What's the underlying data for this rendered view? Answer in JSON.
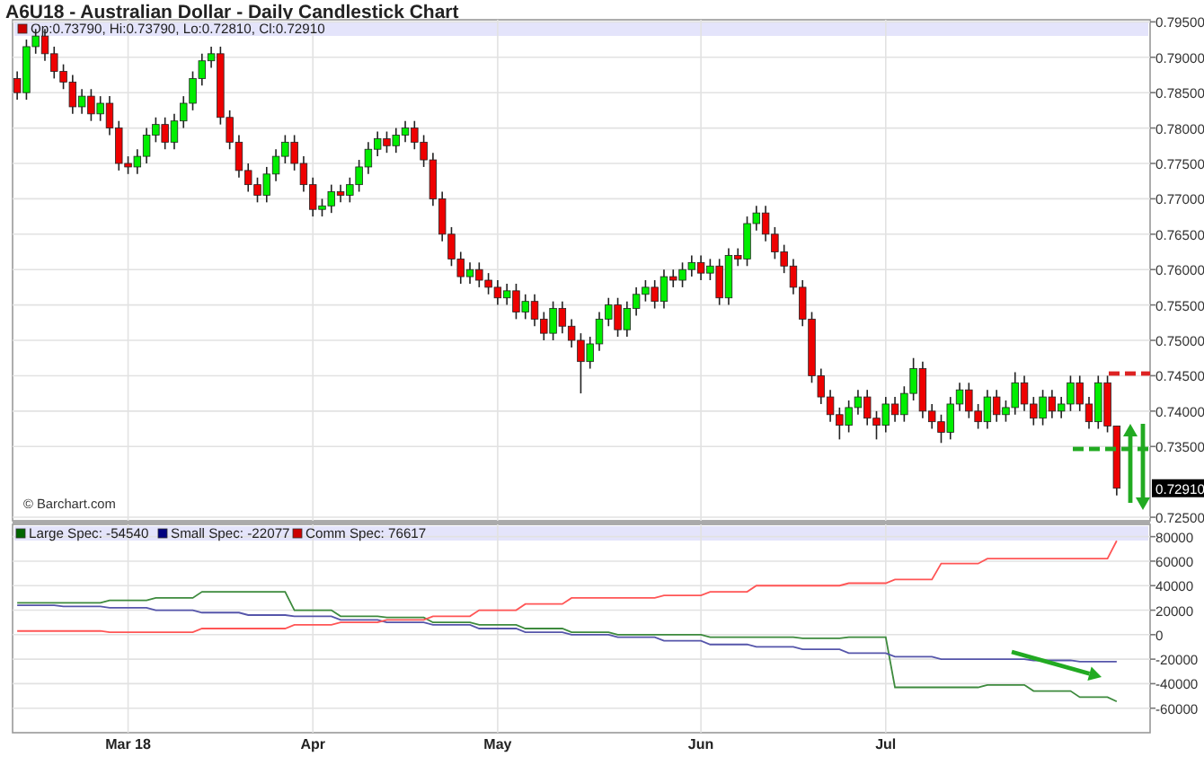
{
  "title": "A6U18 - Australian Dollar - Daily Candlestick Chart",
  "price_chart": {
    "legend": {
      "color": "#cc0000",
      "text": "Op:0.73790, Hi:0.73790, Lo:0.72810, Cl:0.72910"
    },
    "credit": "© Barchart.com",
    "last_price_label": "0.72910",
    "chart_data": {
      "type": "candlestick",
      "categories": [
        null,
        null,
        null,
        null,
        null,
        null,
        null,
        null,
        null,
        null,
        null,
        null,
        null,
        null,
        null,
        null,
        null,
        null,
        null,
        null,
        null,
        null,
        null,
        null,
        null,
        null,
        null,
        null,
        null,
        null,
        null,
        null,
        null,
        null,
        null,
        null,
        null,
        null,
        null,
        null,
        null,
        null,
        null,
        null,
        null,
        null,
        null,
        null,
        null,
        null,
        null,
        null,
        null,
        null,
        null,
        null,
        null,
        null,
        null,
        null,
        null,
        null,
        null,
        null,
        null,
        null,
        null,
        null,
        null,
        null,
        null,
        null,
        null,
        null,
        null,
        null,
        null,
        null,
        null,
        null,
        null,
        null,
        null,
        null,
        null,
        null,
        null,
        null,
        null,
        null,
        null,
        null,
        null,
        null,
        null,
        null,
        null,
        null,
        null,
        null,
        null,
        null,
        null,
        null,
        null,
        null,
        null,
        null,
        null,
        null,
        null,
        null,
        null,
        null,
        null,
        null,
        null,
        null,
        null,
        null
      ],
      "ylim": [
        0.7245,
        0.7953
      ],
      "grid": true,
      "yticks": [
        {
          "value": 0.795,
          "label": "0.79500"
        },
        {
          "value": 0.79,
          "label": "0.79000"
        },
        {
          "value": 0.785,
          "label": "0.78500"
        },
        {
          "value": 0.78,
          "label": "0.78000"
        },
        {
          "value": 0.775,
          "label": "0.77500"
        },
        {
          "value": 0.77,
          "label": "0.77000"
        },
        {
          "value": 0.765,
          "label": "0.76500"
        },
        {
          "value": 0.76,
          "label": "0.76000"
        },
        {
          "value": 0.755,
          "label": "0.75500"
        },
        {
          "value": 0.75,
          "label": "0.75000"
        },
        {
          "value": 0.745,
          "label": "0.74500"
        },
        {
          "value": 0.74,
          "label": "0.74000"
        },
        {
          "value": 0.735,
          "label": "0.73500"
        },
        {
          "value": 0.725,
          "label": "0.72500"
        }
      ],
      "ohlc": [
        [
          0.787,
          0.788,
          0.784,
          0.785
        ],
        [
          0.785,
          0.7925,
          0.784,
          0.7915
        ],
        [
          0.7915,
          0.794,
          0.7905,
          0.793
        ],
        [
          0.793,
          0.794,
          0.7895,
          0.7905
        ],
        [
          0.7905,
          0.7915,
          0.787,
          0.788
        ],
        [
          0.788,
          0.789,
          0.7855,
          0.7865
        ],
        [
          0.7865,
          0.7875,
          0.782,
          0.783
        ],
        [
          0.783,
          0.7855,
          0.782,
          0.7845
        ],
        [
          0.7845,
          0.7855,
          0.781,
          0.782
        ],
        [
          0.782,
          0.7845,
          0.781,
          0.7835
        ],
        [
          0.7835,
          0.7845,
          0.779,
          0.78
        ],
        [
          0.78,
          0.781,
          0.774,
          0.775
        ],
        [
          0.775,
          0.776,
          0.7735,
          0.7745
        ],
        [
          0.7745,
          0.777,
          0.7735,
          0.776
        ],
        [
          0.776,
          0.78,
          0.775,
          0.779
        ],
        [
          0.779,
          0.7815,
          0.778,
          0.7805
        ],
        [
          0.7805,
          0.7815,
          0.777,
          0.778
        ],
        [
          0.778,
          0.782,
          0.777,
          0.781
        ],
        [
          0.781,
          0.7845,
          0.78,
          0.7835
        ],
        [
          0.7835,
          0.788,
          0.7825,
          0.787
        ],
        [
          0.787,
          0.7905,
          0.786,
          0.7895
        ],
        [
          0.7895,
          0.7915,
          0.7885,
          0.7905
        ],
        [
          0.7905,
          0.7915,
          0.7805,
          0.7815
        ],
        [
          0.7815,
          0.7825,
          0.777,
          0.778
        ],
        [
          0.778,
          0.779,
          0.773,
          0.774
        ],
        [
          0.774,
          0.775,
          0.771,
          0.772
        ],
        [
          0.772,
          0.773,
          0.7695,
          0.7705
        ],
        [
          0.7705,
          0.7745,
          0.7695,
          0.7735
        ],
        [
          0.7735,
          0.777,
          0.7725,
          0.776
        ],
        [
          0.776,
          0.779,
          0.775,
          0.778
        ],
        [
          0.778,
          0.779,
          0.774,
          0.775
        ],
        [
          0.775,
          0.776,
          0.771,
          0.772
        ],
        [
          0.772,
          0.773,
          0.7675,
          0.7685
        ],
        [
          0.7685,
          0.77,
          0.7675,
          0.769
        ],
        [
          0.769,
          0.772,
          0.768,
          0.771
        ],
        [
          0.771,
          0.772,
          0.7695,
          0.7705
        ],
        [
          0.7705,
          0.773,
          0.7695,
          0.772
        ],
        [
          0.772,
          0.7755,
          0.771,
          0.7745
        ],
        [
          0.7745,
          0.778,
          0.7735,
          0.777
        ],
        [
          0.777,
          0.7795,
          0.776,
          0.7785
        ],
        [
          0.7785,
          0.7795,
          0.7765,
          0.7775
        ],
        [
          0.7775,
          0.78,
          0.7765,
          0.779
        ],
        [
          0.779,
          0.781,
          0.778,
          0.78
        ],
        [
          0.78,
          0.781,
          0.777,
          0.778
        ],
        [
          0.778,
          0.779,
          0.7745,
          0.7755
        ],
        [
          0.7755,
          0.7765,
          0.769,
          0.77
        ],
        [
          0.77,
          0.771,
          0.764,
          0.765
        ],
        [
          0.765,
          0.766,
          0.7605,
          0.7615
        ],
        [
          0.7615,
          0.7625,
          0.758,
          0.759
        ],
        [
          0.759,
          0.761,
          0.758,
          0.76
        ],
        [
          0.76,
          0.761,
          0.7575,
          0.7585
        ],
        [
          0.7585,
          0.7595,
          0.7565,
          0.7575
        ],
        [
          0.7575,
          0.7585,
          0.755,
          0.756
        ],
        [
          0.756,
          0.758,
          0.755,
          0.757
        ],
        [
          0.757,
          0.758,
          0.753,
          0.754
        ],
        [
          0.754,
          0.7565,
          0.753,
          0.7555
        ],
        [
          0.7555,
          0.7565,
          0.752,
          0.753
        ],
        [
          0.753,
          0.754,
          0.75,
          0.751
        ],
        [
          0.751,
          0.7555,
          0.75,
          0.7545
        ],
        [
          0.7545,
          0.7555,
          0.751,
          0.752
        ],
        [
          0.752,
          0.753,
          0.749,
          0.75
        ],
        [
          0.75,
          0.751,
          0.7425,
          0.747
        ],
        [
          0.747,
          0.7505,
          0.746,
          0.7495
        ],
        [
          0.7495,
          0.754,
          0.7485,
          0.753
        ],
        [
          0.753,
          0.756,
          0.752,
          0.755
        ],
        [
          0.755,
          0.756,
          0.7505,
          0.7515
        ],
        [
          0.7515,
          0.7555,
          0.7505,
          0.7545
        ],
        [
          0.7545,
          0.7575,
          0.7535,
          0.7565
        ],
        [
          0.7565,
          0.7585,
          0.7555,
          0.7575
        ],
        [
          0.7575,
          0.7585,
          0.7545,
          0.7555
        ],
        [
          0.7555,
          0.76,
          0.7545,
          0.759
        ],
        [
          0.759,
          0.76,
          0.7575,
          0.7585
        ],
        [
          0.7585,
          0.761,
          0.7575,
          0.76
        ],
        [
          0.76,
          0.762,
          0.759,
          0.761
        ],
        [
          0.761,
          0.762,
          0.7585,
          0.7595
        ],
        [
          0.7595,
          0.7615,
          0.7585,
          0.7605
        ],
        [
          0.7605,
          0.7615,
          0.755,
          0.756
        ],
        [
          0.756,
          0.763,
          0.755,
          0.762
        ],
        [
          0.762,
          0.763,
          0.7605,
          0.7615
        ],
        [
          0.7615,
          0.7675,
          0.7605,
          0.7665
        ],
        [
          0.7665,
          0.769,
          0.7655,
          0.768
        ],
        [
          0.768,
          0.769,
          0.764,
          0.765
        ],
        [
          0.765,
          0.766,
          0.7615,
          0.7625
        ],
        [
          0.7625,
          0.7635,
          0.7595,
          0.7605
        ],
        [
          0.7605,
          0.7615,
          0.7565,
          0.7575
        ],
        [
          0.7575,
          0.7585,
          0.752,
          0.753
        ],
        [
          0.753,
          0.754,
          0.744,
          0.745
        ],
        [
          0.745,
          0.746,
          0.741,
          0.742
        ],
        [
          0.742,
          0.743,
          0.7385,
          0.7395
        ],
        [
          0.7395,
          0.7405,
          0.736,
          0.738
        ],
        [
          0.738,
          0.7415,
          0.737,
          0.7405
        ],
        [
          0.7405,
          0.743,
          0.7395,
          0.742
        ],
        [
          0.742,
          0.743,
          0.738,
          0.739
        ],
        [
          0.739,
          0.74,
          0.736,
          0.738
        ],
        [
          0.738,
          0.742,
          0.737,
          0.741
        ],
        [
          0.741,
          0.742,
          0.7385,
          0.7395
        ],
        [
          0.7395,
          0.7435,
          0.7385,
          0.7425
        ],
        [
          0.7425,
          0.7475,
          0.7415,
          0.746
        ],
        [
          0.746,
          0.747,
          0.739,
          0.74
        ],
        [
          0.74,
          0.741,
          0.7375,
          0.7385
        ],
        [
          0.7385,
          0.7395,
          0.7355,
          0.737
        ],
        [
          0.737,
          0.742,
          0.736,
          0.741
        ],
        [
          0.741,
          0.744,
          0.74,
          0.743
        ],
        [
          0.743,
          0.744,
          0.739,
          0.74
        ],
        [
          0.74,
          0.741,
          0.7375,
          0.7385
        ],
        [
          0.7385,
          0.743,
          0.7375,
          0.742
        ],
        [
          0.742,
          0.743,
          0.7385,
          0.7395
        ],
        [
          0.7395,
          0.7415,
          0.7385,
          0.7405
        ],
        [
          0.7405,
          0.7455,
          0.7395,
          0.744
        ],
        [
          0.744,
          0.745,
          0.74,
          0.741
        ],
        [
          0.741,
          0.742,
          0.738,
          0.739
        ],
        [
          0.739,
          0.743,
          0.738,
          0.742
        ],
        [
          0.742,
          0.743,
          0.739,
          0.74
        ],
        [
          0.74,
          0.742,
          0.739,
          0.741
        ],
        [
          0.741,
          0.745,
          0.74,
          0.744
        ],
        [
          0.744,
          0.745,
          0.74,
          0.741
        ],
        [
          0.741,
          0.742,
          0.7375,
          0.7385
        ],
        [
          0.7385,
          0.745,
          0.7375,
          0.744
        ],
        [
          0.744,
          0.745,
          0.737,
          0.7379
        ],
        [
          0.7379,
          0.7379,
          0.7281,
          0.7291
        ]
      ]
    },
    "markers": [
      {
        "kind": "dashed_line",
        "color": "#dd2222"
      },
      {
        "kind": "dashed_line",
        "color": "#22aa22"
      },
      {
        "kind": "arrow",
        "color": "#22aa22"
      },
      {
        "kind": "arrow",
        "color": "#22aa22"
      }
    ]
  },
  "cot_chart": {
    "legend": [
      {
        "text": "Large Spec: -54540",
        "color": "#006600"
      },
      {
        "text": "Small Spec: -22077",
        "color": "#000080"
      },
      {
        "text": "Comm Spec: 76617",
        "color": "#cc0000"
      }
    ],
    "chart_data": {
      "type": "line",
      "ylim": [
        -80000,
        90000
      ],
      "grid": true,
      "categories": [
        null,
        null,
        null,
        null,
        null,
        null,
        null,
        null,
        null,
        null,
        null,
        null,
        "Mar 18",
        null,
        null,
        null,
        null,
        null,
        null,
        null,
        null,
        null,
        null,
        null,
        null,
        null,
        null,
        null,
        null,
        null,
        null,
        null,
        "Apr",
        null,
        null,
        null,
        null,
        null,
        null,
        null,
        null,
        null,
        null,
        null,
        null,
        null,
        null,
        null,
        null,
        null,
        null,
        null,
        "May",
        null,
        null,
        null,
        null,
        null,
        null,
        null,
        null,
        null,
        null,
        null,
        null,
        null,
        null,
        null,
        null,
        null,
        null,
        null,
        null,
        null,
        "Jun",
        null,
        null,
        null,
        null,
        null,
        null,
        null,
        null,
        null,
        null,
        null,
        null,
        null,
        null,
        null,
        null,
        null,
        null,
        null,
        "Jul",
        null,
        null,
        null,
        null,
        null,
        null,
        null,
        null,
        null,
        null,
        null,
        null,
        null,
        null,
        null,
        null,
        null,
        null,
        null,
        null,
        null,
        null,
        null,
        null,
        null
      ],
      "yticks": [
        80000,
        60000,
        40000,
        20000,
        0,
        -20000,
        -40000,
        -60000
      ],
      "series": [
        {
          "color": "#3d8a3d",
          "values": [
            26000,
            26000,
            26000,
            26000,
            26000,
            26000,
            26000,
            26000,
            26000,
            26000,
            28000,
            28000,
            28000,
            28000,
            28000,
            30000,
            30000,
            30000,
            30000,
            30000,
            35000,
            35000,
            35000,
            35000,
            35000,
            35000,
            35000,
            35000,
            35000,
            35000,
            20000,
            20000,
            20000,
            20000,
            20000,
            15000,
            15000,
            15000,
            15000,
            15000,
            14000,
            14000,
            14000,
            14000,
            14000,
            10000,
            10000,
            10000,
            10000,
            10000,
            8000,
            8000,
            8000,
            8000,
            8000,
            5000,
            5000,
            5000,
            5000,
            5000,
            2000,
            2000,
            2000,
            2000,
            2000,
            0,
            0,
            0,
            0,
            0,
            0,
            0,
            0,
            0,
            0,
            -2000,
            -2000,
            -2000,
            -2000,
            -2000,
            -2000,
            -2000,
            -2000,
            -2000,
            -2000,
            -3000,
            -3000,
            -3000,
            -3000,
            -3000,
            -2000,
            -2000,
            -2000,
            -2000,
            -2000,
            -43000,
            -43000,
            -43000,
            -43000,
            -43000,
            -43000,
            -43000,
            -43000,
            -43000,
            -43000,
            -41000,
            -41000,
            -41000,
            -41000,
            -41000,
            -46000,
            -46000,
            -46000,
            -46000,
            -46000,
            -51000,
            -51000,
            -51000,
            -51000,
            -54540
          ]
        },
        {
          "color": "#5555aa",
          "values": [
            24000,
            24000,
            24000,
            24000,
            24000,
            23000,
            23000,
            23000,
            23000,
            23000,
            22000,
            22000,
            22000,
            22000,
            22000,
            20000,
            20000,
            20000,
            20000,
            20000,
            18000,
            18000,
            18000,
            18000,
            18000,
            16000,
            16000,
            16000,
            16000,
            16000,
            15000,
            15000,
            15000,
            15000,
            15000,
            12000,
            12000,
            12000,
            12000,
            12000,
            10000,
            10000,
            10000,
            10000,
            10000,
            8000,
            8000,
            8000,
            8000,
            8000,
            5000,
            5000,
            5000,
            5000,
            5000,
            2000,
            2000,
            2000,
            2000,
            2000,
            0,
            0,
            0,
            0,
            0,
            -2000,
            -2000,
            -2000,
            -2000,
            -2000,
            -5000,
            -5000,
            -5000,
            -5000,
            -5000,
            -8000,
            -8000,
            -8000,
            -8000,
            -8000,
            -10000,
            -10000,
            -10000,
            -10000,
            -10000,
            -12000,
            -12000,
            -12000,
            -12000,
            -12000,
            -15000,
            -15000,
            -15000,
            -15000,
            -15000,
            -18000,
            -18000,
            -18000,
            -18000,
            -18000,
            -20000,
            -20000,
            -20000,
            -20000,
            -20000,
            -20000,
            -20000,
            -20000,
            -20000,
            -20000,
            -21000,
            -21000,
            -21000,
            -21000,
            -21000,
            -22000,
            -22000,
            -22000,
            -22000,
            -22077
          ]
        },
        {
          "color": "#ff5555",
          "values": [
            3000,
            3000,
            3000,
            3000,
            3000,
            3000,
            3000,
            3000,
            3000,
            3000,
            2000,
            2000,
            2000,
            2000,
            2000,
            2000,
            2000,
            2000,
            2000,
            2000,
            5000,
            5000,
            5000,
            5000,
            5000,
            5000,
            5000,
            5000,
            5000,
            5000,
            8000,
            8000,
            8000,
            8000,
            8000,
            10000,
            10000,
            10000,
            10000,
            10000,
            12000,
            12000,
            12000,
            12000,
            12000,
            15000,
            15000,
            15000,
            15000,
            15000,
            20000,
            20000,
            20000,
            20000,
            20000,
            25000,
            25000,
            25000,
            25000,
            25000,
            30000,
            30000,
            30000,
            30000,
            30000,
            30000,
            30000,
            30000,
            30000,
            30000,
            32000,
            32000,
            32000,
            32000,
            32000,
            35000,
            35000,
            35000,
            35000,
            35000,
            40000,
            40000,
            40000,
            40000,
            40000,
            40000,
            40000,
            40000,
            40000,
            40000,
            42000,
            42000,
            42000,
            42000,
            42000,
            45000,
            45000,
            45000,
            45000,
            45000,
            58000,
            58000,
            58000,
            58000,
            58000,
            62000,
            62000,
            62000,
            62000,
            62000,
            62000,
            62000,
            62000,
            62000,
            62000,
            62000,
            62000,
            62000,
            62000,
            76617
          ]
        }
      ]
    },
    "markers": [
      {
        "kind": "arrow",
        "color": "#22aa22"
      }
    ]
  }
}
